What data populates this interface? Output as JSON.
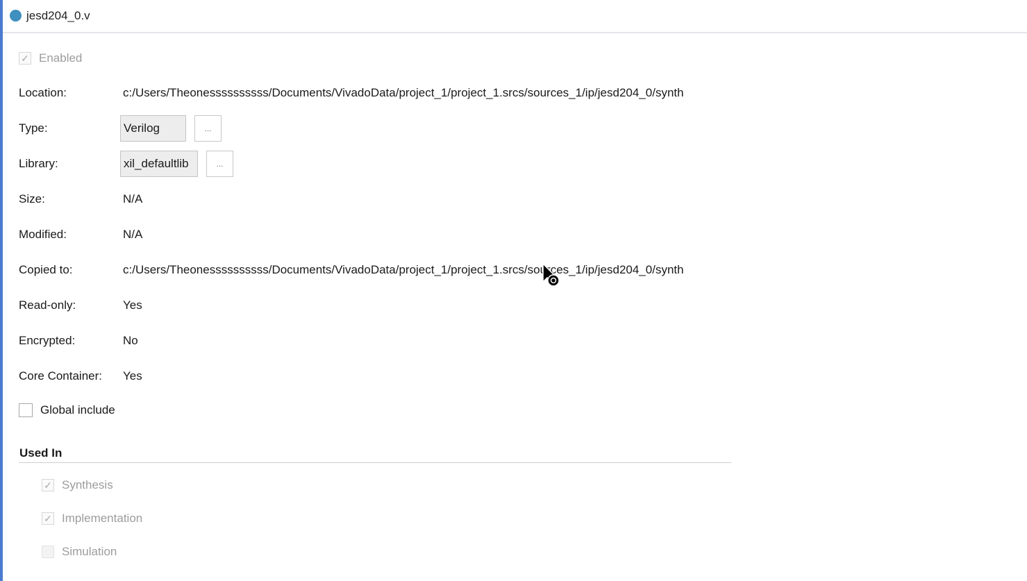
{
  "header": {
    "file_name": "jesd204_0.v"
  },
  "enabled": {
    "label": "Enabled",
    "checked": true
  },
  "properties": {
    "location": {
      "label": "Location:",
      "value": "c:/Users/Theonessssssssss/Documents/VivadoData/project_1/project_1.srcs/sources_1/ip/jesd204_0/synth"
    },
    "type": {
      "label": "Type:",
      "value": "Verilog",
      "button": "..."
    },
    "library": {
      "label": "Library:",
      "value": "xil_defaultlib",
      "button": "..."
    },
    "size": {
      "label": "Size:",
      "value": "N/A"
    },
    "modified": {
      "label": "Modified:",
      "value": "N/A"
    },
    "copied_to": {
      "label": "Copied to:",
      "value": "c:/Users/Theonessssssssss/Documents/VivadoData/project_1/project_1.srcs/sources_1/ip/jesd204_0/synth"
    },
    "read_only": {
      "label": "Read-only:",
      "value": "Yes"
    },
    "encrypted": {
      "label": "Encrypted:",
      "value": "No"
    },
    "core_container": {
      "label": "Core Container:",
      "value": "Yes"
    }
  },
  "global_include": {
    "label": "Global include",
    "checked": false
  },
  "used_in": {
    "title": "Used In",
    "synthesis": {
      "label": "Synthesis",
      "checked": true
    },
    "implementation": {
      "label": "Implementation",
      "checked": true
    },
    "simulation": {
      "label": "Simulation",
      "checked": false
    }
  },
  "colors": {
    "accent": "#4a7bd0",
    "file_dot": "#3f8fbf"
  }
}
